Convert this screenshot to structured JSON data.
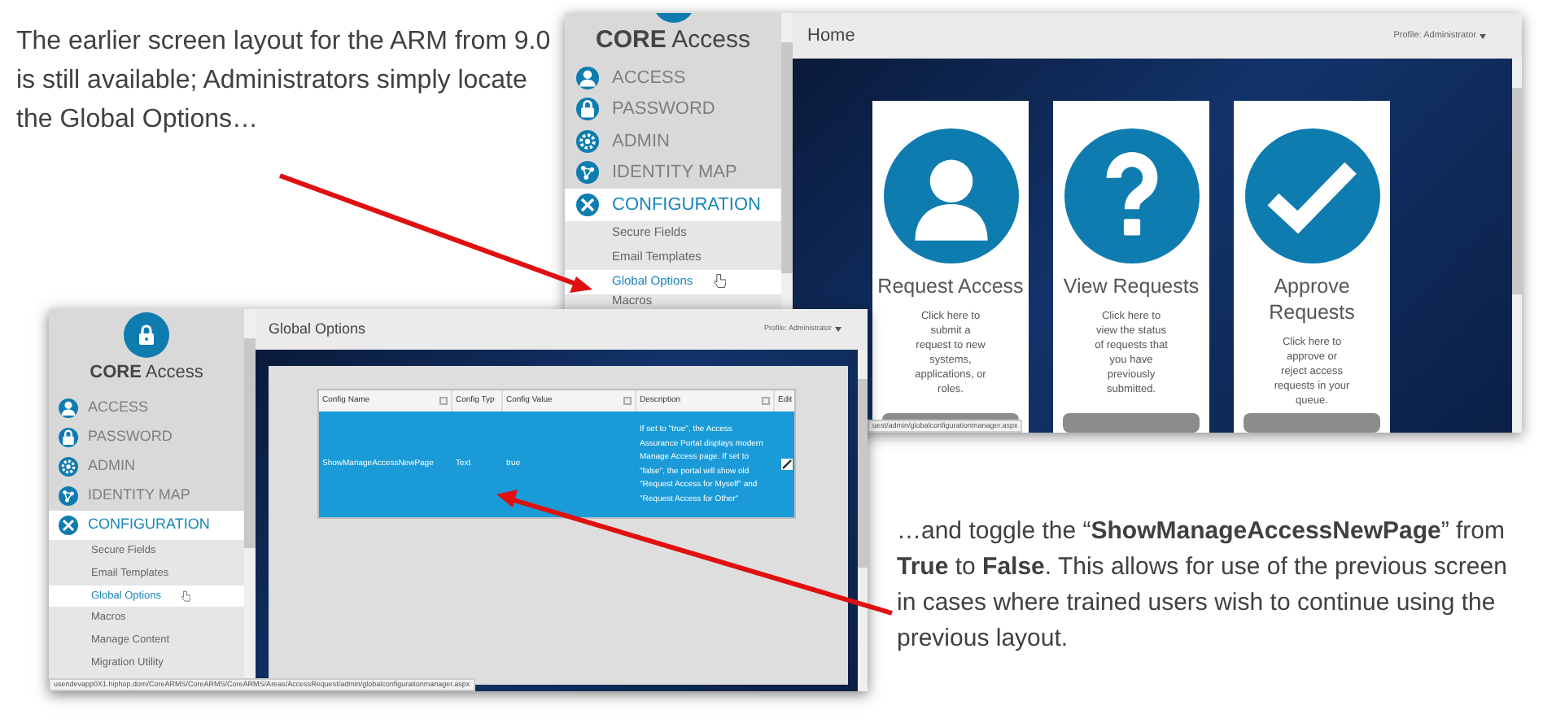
{
  "intro_text": "The earlier screen layout for the ARM from 9.0 is still available; Administrators simply locate the Global Options…",
  "back_window": {
    "logo_text": "**CORE** Access",
    "menu": [
      {
        "label": "ACCESS",
        "selected": false
      },
      {
        "label": "PASSWORD",
        "selected": false
      },
      {
        "label": "ADMIN",
        "selected": false
      },
      {
        "label": "IDENTITY MAP",
        "selected": false
      },
      {
        "label": "CONFIGURATION",
        "selected": true
      }
    ],
    "submenu": [
      {
        "label": "Secure Fields",
        "selected": false
      },
      {
        "label": "Email Templates",
        "selected": false
      },
      {
        "label": "Global Options",
        "selected": true
      },
      {
        "label": "Macros",
        "selected": false
      }
    ],
    "page_title": "Home",
    "profile": "Profile: Administrator",
    "cards": [
      {
        "title": "Request Access",
        "description": "Click here to submit a request to new systems, applications, or roles."
      },
      {
        "title": "View Requests",
        "description": "Click here to view the status of requests that you have previously submitted."
      },
      {
        "title": "Approve Requests",
        "description": "Click here to approve or reject access requests in your queue."
      }
    ],
    "status_url": "uest/admin/globalconfigurationmanager.aspx"
  },
  "front_window": {
    "logo_text": "**CORE** Access",
    "menu": [
      {
        "label": "ACCESS",
        "selected": false
      },
      {
        "label": "PASSWORD",
        "selected": false
      },
      {
        "label": "ADMIN",
        "selected": false
      },
      {
        "label": "IDENTITY MAP",
        "selected": false
      },
      {
        "label": "CONFIGURATION",
        "selected": true
      }
    ],
    "submenu": [
      {
        "label": "Secure Fields",
        "selected": false
      },
      {
        "label": "Email Templates",
        "selected": false
      },
      {
        "label": "Global Options",
        "selected": true
      },
      {
        "label": "Macros",
        "selected": false
      },
      {
        "label": "Manage Content",
        "selected": false
      },
      {
        "label": "Migration Utility",
        "selected": false
      }
    ],
    "page_title": "Global Options",
    "profile": "Profile: Administrator",
    "table": {
      "columns": [
        {
          "label": "Config Name",
          "filter": true
        },
        {
          "label": "Config Typ",
          "filter": false
        },
        {
          "label": "Config Value",
          "filter": true
        },
        {
          "label": "Description",
          "filter": true
        },
        {
          "label": "Edit",
          "filter": false
        }
      ],
      "rows": [
        {
          "selected": true,
          "cells": [
            "ShowManageAccessNewPage",
            "Text",
            "true",
            "If set to \"true\", the Access Assurance Portal displays modern Manage Access page. If set to \"false\", the portal will show old \"Request Access for Myself\" and \"Request Access for Other\""
          ]
        }
      ]
    },
    "status_url": "usendevapp0X1.hiphop.dom/CoreARMS/CoreARMS/CoreARMS/Areas/AccessRequest/admin/globalconfigurationmanager.aspx"
  },
  "callout_text": "…and toggle the “**ShowManageAccessNewPage**” from **True** to **False**. This allows for use of the previous screen in cases where trained users wish to continue using the previous layout."
}
